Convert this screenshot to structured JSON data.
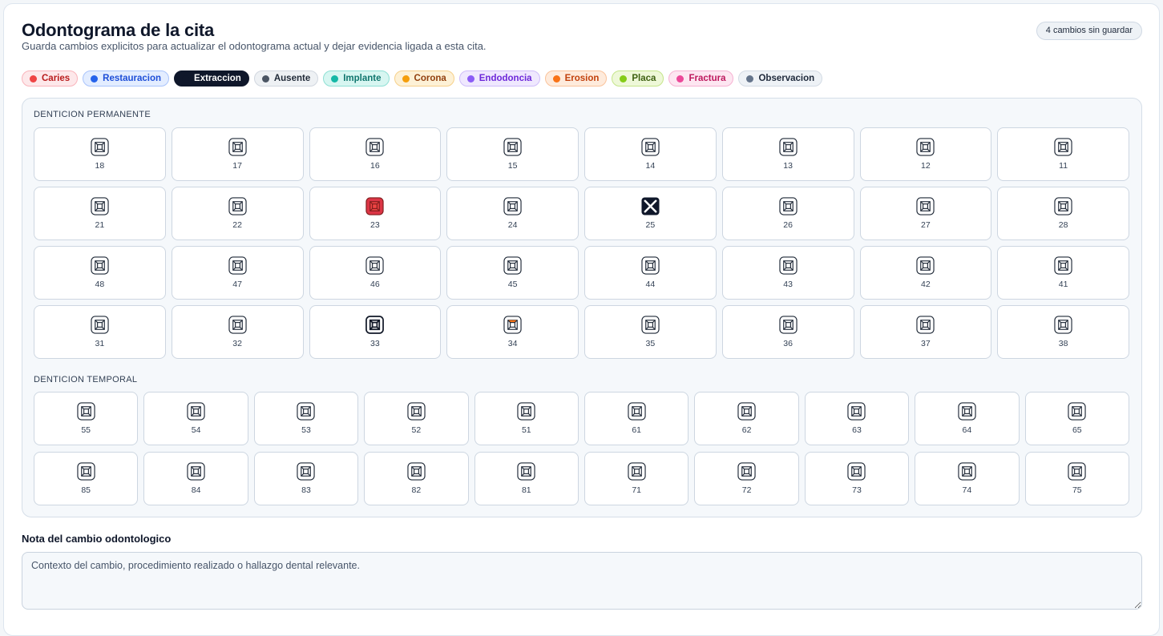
{
  "header": {
    "title": "Odontograma de la cita",
    "subtitle": "Guarda cambios explicitos para actualizar el odontograma actual y dejar evidencia ligada a esta cita.",
    "pending_badge": "4 cambios sin guardar"
  },
  "legend": [
    {
      "key": "caries",
      "label": "Caries",
      "dot": "#ef4444",
      "bg": "#fde8ea",
      "border": "#f9b4bb",
      "text": "#b91c1c",
      "active": false
    },
    {
      "key": "restauracion",
      "label": "Restauracion",
      "dot": "#2563eb",
      "bg": "#e3edff",
      "border": "#a9c4fb",
      "text": "#1d4ed8",
      "active": false
    },
    {
      "key": "extraccion",
      "label": "Extraccion",
      "dot": "#0f172a",
      "bg": "#0f172a",
      "border": "#0f172a",
      "text": "#ffffff",
      "active": true
    },
    {
      "key": "ausente",
      "label": "Ausente",
      "dot": "#4b5563",
      "bg": "#eef1f4",
      "border": "#d1d7df",
      "text": "#1f2937",
      "active": false
    },
    {
      "key": "implante",
      "label": "Implante",
      "dot": "#14b8a6",
      "bg": "#d7f6f1",
      "border": "#8fe0d4",
      "text": "#0f766e",
      "active": false
    },
    {
      "key": "corona",
      "label": "Corona",
      "dot": "#f59e0b",
      "bg": "#fdf1d6",
      "border": "#f6d08a",
      "text": "#92400e",
      "active": false
    },
    {
      "key": "endodoncia",
      "label": "Endodoncia",
      "dot": "#8b5cf6",
      "bg": "#efe8fe",
      "border": "#cfbdfa",
      "text": "#6d28d9",
      "active": false
    },
    {
      "key": "erosion",
      "label": "Erosion",
      "dot": "#f97316",
      "bg": "#feebdc",
      "border": "#fac39b",
      "text": "#c2410c",
      "active": false
    },
    {
      "key": "placa",
      "label": "Placa",
      "dot": "#84cc16",
      "bg": "#eef8d8",
      "border": "#c5e58a",
      "text": "#3f6212",
      "active": false
    },
    {
      "key": "fractura",
      "label": "Fractura",
      "dot": "#ec4899",
      "bg": "#fde6f1",
      "border": "#f6b2d2",
      "text": "#be185d",
      "active": false
    },
    {
      "key": "observacion",
      "label": "Observacion",
      "dot": "#64748b",
      "bg": "#eef2f6",
      "border": "#d3dbe4",
      "text": "#1e293b",
      "active": false
    }
  ],
  "permanent": {
    "label": "DENTICION PERMANENTE",
    "teeth": [
      {
        "num": "18",
        "status": "sano"
      },
      {
        "num": "17",
        "status": "sano"
      },
      {
        "num": "16",
        "status": "sano"
      },
      {
        "num": "15",
        "status": "sano"
      },
      {
        "num": "14",
        "status": "sano"
      },
      {
        "num": "13",
        "status": "sano"
      },
      {
        "num": "12",
        "status": "sano"
      },
      {
        "num": "11",
        "status": "sano"
      },
      {
        "num": "21",
        "status": "sano"
      },
      {
        "num": "22",
        "status": "sano"
      },
      {
        "num": "23",
        "status": "caries"
      },
      {
        "num": "24",
        "status": "sano"
      },
      {
        "num": "25",
        "status": "extraccion"
      },
      {
        "num": "26",
        "status": "sano"
      },
      {
        "num": "27",
        "status": "sano"
      },
      {
        "num": "28",
        "status": "sano"
      },
      {
        "num": "48",
        "status": "sano"
      },
      {
        "num": "47",
        "status": "sano"
      },
      {
        "num": "46",
        "status": "sano"
      },
      {
        "num": "45",
        "status": "sano"
      },
      {
        "num": "44",
        "status": "sano"
      },
      {
        "num": "43",
        "status": "sano"
      },
      {
        "num": "42",
        "status": "sano"
      },
      {
        "num": "41",
        "status": "sano"
      },
      {
        "num": "31",
        "status": "sano"
      },
      {
        "num": "32",
        "status": "sano"
      },
      {
        "num": "33",
        "status": "ausente"
      },
      {
        "num": "34",
        "status": "erosion"
      },
      {
        "num": "35",
        "status": "sano"
      },
      {
        "num": "36",
        "status": "sano"
      },
      {
        "num": "37",
        "status": "sano"
      },
      {
        "num": "38",
        "status": "sano"
      }
    ]
  },
  "temporary": {
    "label": "DENTICION TEMPORAL",
    "teeth": [
      {
        "num": "55",
        "status": "sano"
      },
      {
        "num": "54",
        "status": "sano"
      },
      {
        "num": "53",
        "status": "sano"
      },
      {
        "num": "52",
        "status": "sano"
      },
      {
        "num": "51",
        "status": "sano"
      },
      {
        "num": "61",
        "status": "sano"
      },
      {
        "num": "62",
        "status": "sano"
      },
      {
        "num": "63",
        "status": "sano"
      },
      {
        "num": "64",
        "status": "sano"
      },
      {
        "num": "65",
        "status": "sano"
      },
      {
        "num": "85",
        "status": "sano"
      },
      {
        "num": "84",
        "status": "sano"
      },
      {
        "num": "83",
        "status": "sano"
      },
      {
        "num": "82",
        "status": "sano"
      },
      {
        "num": "81",
        "status": "sano"
      },
      {
        "num": "71",
        "status": "sano"
      },
      {
        "num": "72",
        "status": "sano"
      },
      {
        "num": "73",
        "status": "sano"
      },
      {
        "num": "74",
        "status": "sano"
      },
      {
        "num": "75",
        "status": "sano"
      }
    ]
  },
  "note": {
    "label": "Nota del cambio odontologico",
    "placeholder": "Contexto del cambio, procedimiento realizado o hallazgo dental relevante."
  }
}
